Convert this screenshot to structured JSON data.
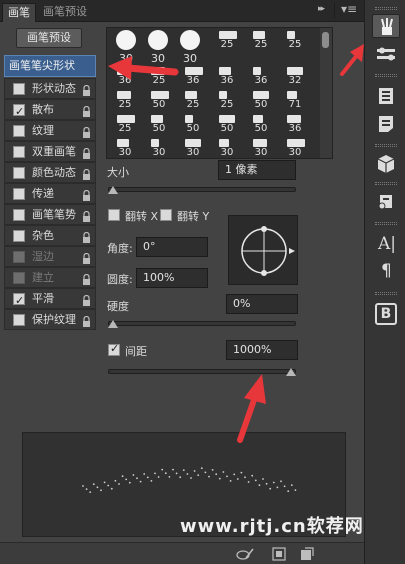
{
  "tabs": [
    {
      "label": "画笔",
      "active": true
    },
    {
      "label": "画笔预设",
      "active": false
    }
  ],
  "tabbar_icons": {
    "collapse": "double-chevron-right-icon",
    "menu": "panel-menu-icon",
    "collapse_glyph": "▸▸",
    "menu_glyph": "▾≡"
  },
  "preset_button": "画笔预设",
  "tip_shape_item": "画笔笔尖形状",
  "options": [
    {
      "label": "形状动态",
      "checked": false,
      "enabled": true
    },
    {
      "label": "散布",
      "checked": true,
      "enabled": true
    },
    {
      "label": "纹理",
      "checked": false,
      "enabled": true
    },
    {
      "label": "双重画笔",
      "checked": false,
      "enabled": true
    },
    {
      "label": "颜色动态",
      "checked": false,
      "enabled": true
    },
    {
      "label": "传递",
      "checked": false,
      "enabled": true
    },
    {
      "label": "画笔笔势",
      "checked": false,
      "enabled": true
    },
    {
      "label": "杂色",
      "checked": false,
      "enabled": true
    },
    {
      "label": "湿边",
      "checked": false,
      "enabled": false
    },
    {
      "label": "建立",
      "checked": false,
      "enabled": false
    },
    {
      "label": "平滑",
      "checked": true,
      "enabled": true
    },
    {
      "label": "保护纹理",
      "checked": false,
      "enabled": true
    }
  ],
  "brush_grid": {
    "top_row": [
      "30",
      "30",
      "30"
    ],
    "rows": [
      [
        "25",
        "25",
        "25"
      ],
      [
        "36",
        "25",
        "36",
        "36",
        "36",
        "32"
      ],
      [
        "25",
        "50",
        "25",
        "25",
        "50",
        "71"
      ],
      [
        "25",
        "50",
        "50",
        "50",
        "50",
        "36"
      ],
      [
        "30",
        "30",
        "30",
        "30",
        "30",
        "30"
      ]
    ]
  },
  "size": {
    "label": "大小",
    "value": "1 像素",
    "level": 0
  },
  "flip_x": {
    "label": "翻转 X",
    "checked": false
  },
  "flip_y": {
    "label": "翻转 Y",
    "checked": false
  },
  "angle": {
    "label": "角度:",
    "value": "0°"
  },
  "roundness": {
    "label": "圆度:",
    "value": "100%"
  },
  "hardness": {
    "label": "硬度",
    "value": "0%",
    "level": 0
  },
  "spacing": {
    "label": "间距",
    "value": "1000%",
    "checked": true,
    "level": 1
  },
  "watermark": "www.rjtj.cn软荐网",
  "colors": {
    "panel_bg": "#434343",
    "selected": "#3a5f8f",
    "arrow": "#e8373b"
  },
  "dock_icons": [
    "brush-panel-icon",
    "brush-presets-icon",
    "layer-comps-icon",
    "notes-icon",
    "3d-icon",
    "properties-icon",
    "character-icon",
    "paragraph-icon",
    "styles-icon"
  ],
  "dock_glyphs": {
    "character": "A|",
    "paragraph": "¶",
    "styles": "B"
  },
  "bottom_icons": [
    "toggle-hardness-icon",
    "create-brush-icon",
    "new-brush-icon"
  ]
}
